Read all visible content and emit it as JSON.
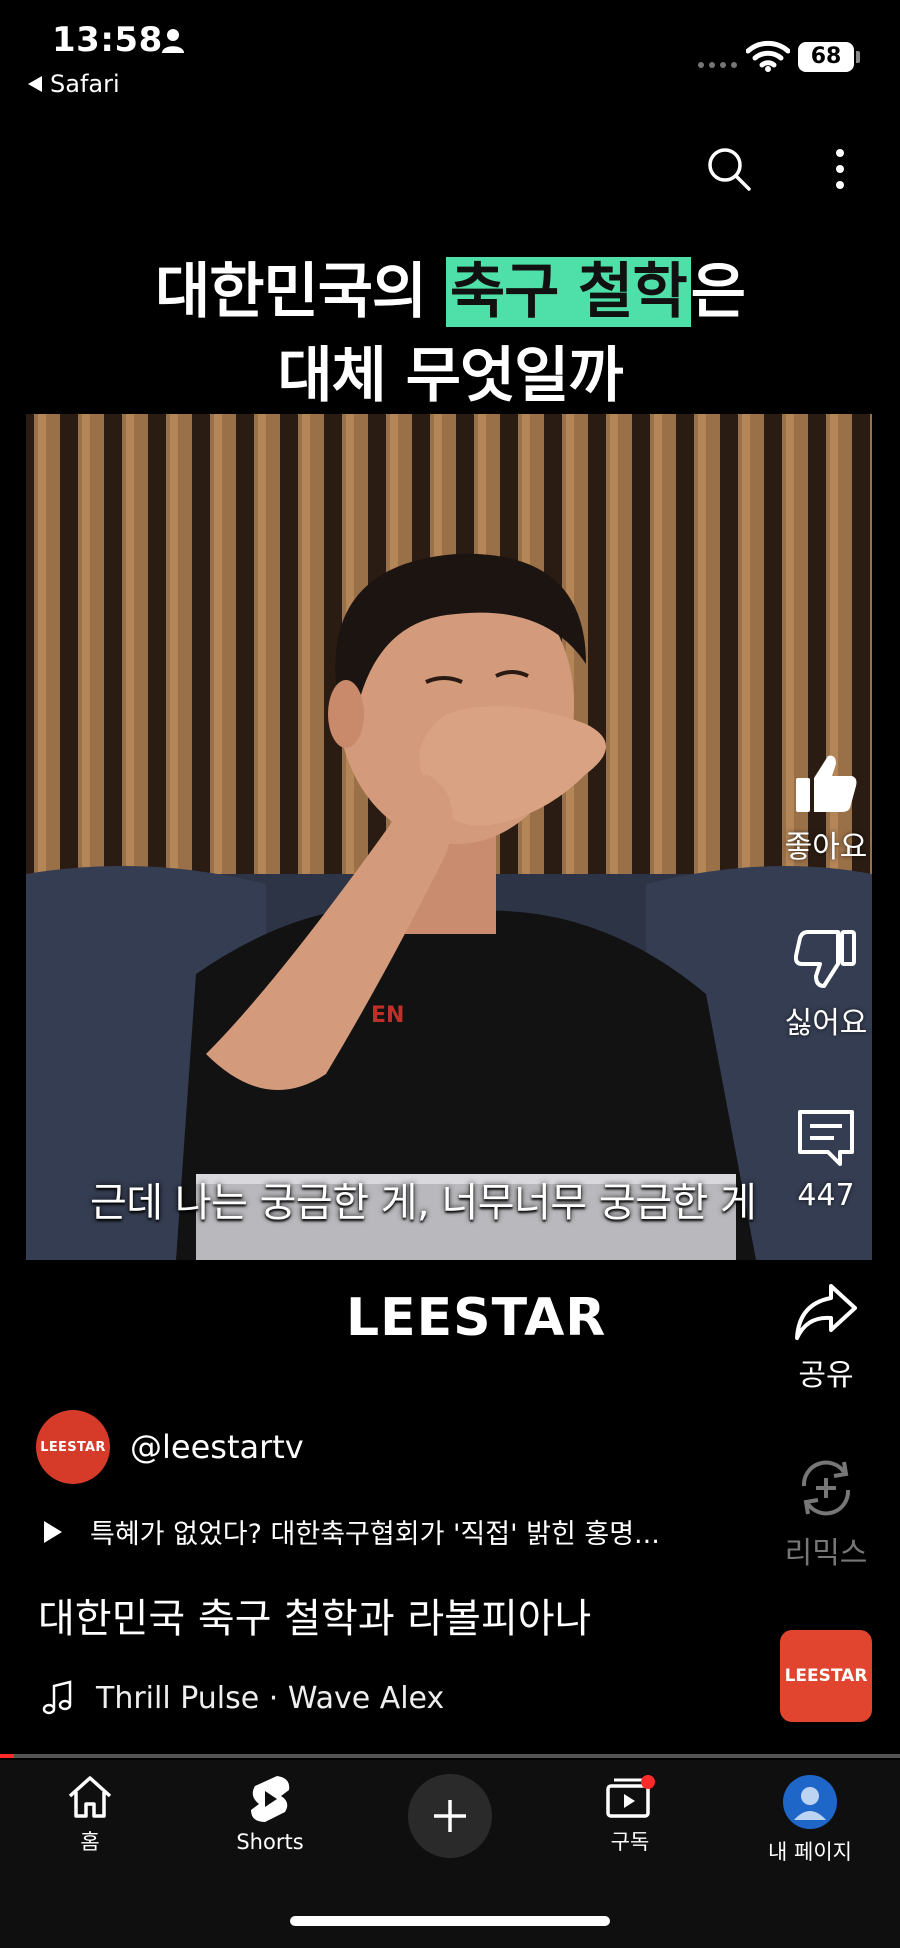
{
  "status_bar": {
    "time": "13:58",
    "back_app": "Safari",
    "battery": "68"
  },
  "overlay_title": {
    "line1_before": "대한민국의 ",
    "line1_highlight": "축구 철학",
    "line1_after": "은",
    "line2": "대체 무엇일까"
  },
  "video": {
    "subtitle": "근데 나는 궁금한 게, 너무너무 궁금한 게",
    "brand_logo": "LEESTAR"
  },
  "actions": {
    "like_label": "좋아요",
    "dislike_label": "싫어요",
    "comments_count": "447",
    "share_label": "공유",
    "remix_label": "리믹스"
  },
  "channel": {
    "avatar_text": "LEESTAR",
    "handle": "@leestartv"
  },
  "related_video": "특혜가 없었다? 대한축구협회가 '직접' 밝힌 홍명...",
  "video_title": "대한민국 축구 철학과 라볼피아나",
  "music": {
    "track": "Thrill Pulse · Wave Alex",
    "thumb_text": "LEESTAR"
  },
  "progress": {
    "fraction": 0.015
  },
  "nav": {
    "home": "홈",
    "shorts": "Shorts",
    "subscriptions": "구독",
    "you": "내 페이지"
  },
  "colors": {
    "highlight": "#4ee0a8",
    "progress": "#ff2a2a",
    "brand": "#e1442f"
  }
}
